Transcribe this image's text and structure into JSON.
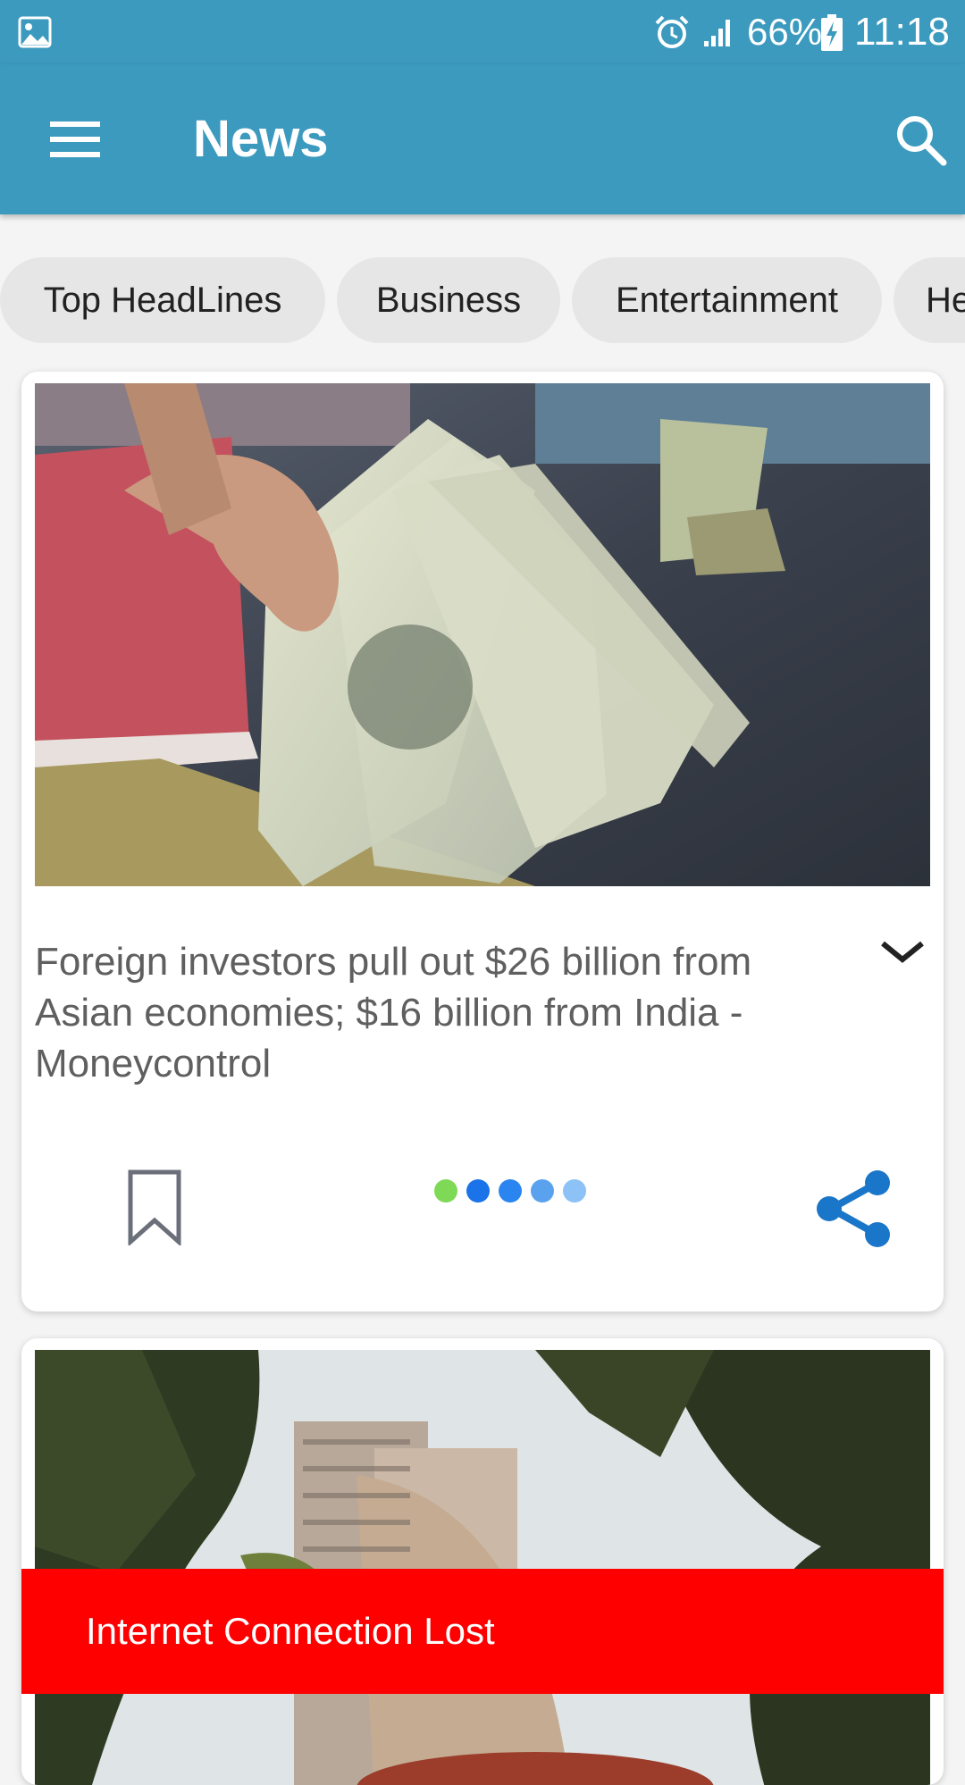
{
  "status_bar": {
    "battery_percent": "66%",
    "time": "11:18",
    "icons": [
      "gallery-icon",
      "alarm-icon",
      "signal-icon",
      "battery-charging-icon"
    ]
  },
  "app_bar": {
    "title": "News",
    "menu_icon": "hamburger-menu-icon",
    "search_icon": "search-icon",
    "color": "#3b9abe"
  },
  "categories": [
    "Top HeadLines",
    "Business",
    "Entertainment",
    "He"
  ],
  "articles": [
    {
      "headline": "Foreign investors pull out $26 billion from Asian economies; $16 billion from India - Moneycontrol",
      "image": "hand holding fanned US 100 dollar bills",
      "bookmark_icon": "bookmark-outline-icon",
      "share_icon": "share-icon",
      "expand_icon": "chevron-down-icon",
      "loading_dot_colors": [
        "#7ed957",
        "#1a73e8",
        "#2a85f0",
        "#5aa2ee",
        "#8cc2f5"
      ]
    },
    {
      "image": "tall building seen through tree branches"
    }
  ],
  "snackbar": {
    "message": "Internet Connection Lost",
    "color": "#ff0000"
  }
}
